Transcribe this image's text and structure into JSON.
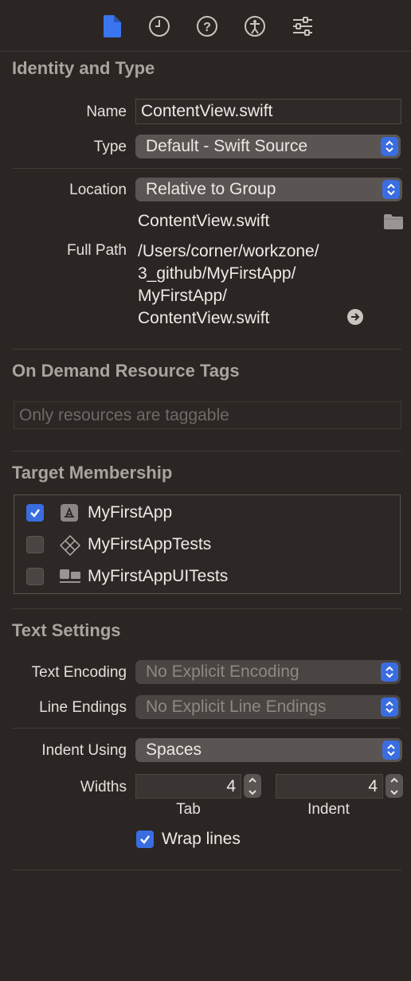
{
  "toolbar": {
    "tabs": [
      {
        "icon": "file-inspector-icon",
        "active": true
      },
      {
        "icon": "history-clock-icon",
        "active": false
      },
      {
        "icon": "help-question-icon",
        "active": false
      },
      {
        "icon": "accessibility-icon",
        "active": false
      },
      {
        "icon": "sliders-icon",
        "active": false
      }
    ],
    "accent": "#3a75f0"
  },
  "identity": {
    "title": "Identity and Type",
    "name_label": "Name",
    "name_value": "ContentView.swift",
    "type_label": "Type",
    "type_value": "Default - Swift Source",
    "location_label": "Location",
    "location_value": "Relative to Group",
    "file_name": "ContentView.swift",
    "full_path_label": "Full Path",
    "full_path_lines": [
      "/Users/corner/workzone/",
      "3_github/MyFirstApp/",
      "MyFirstApp/",
      "ContentView.swift"
    ]
  },
  "odr": {
    "title": "On Demand Resource Tags",
    "placeholder": "Only resources are taggable"
  },
  "target_membership": {
    "title": "Target Membership",
    "targets": [
      {
        "name": "MyFirstApp",
        "checked": true,
        "icon": "app-icon"
      },
      {
        "name": "MyFirstAppTests",
        "checked": false,
        "icon": "test-bundle-icon"
      },
      {
        "name": "MyFirstAppUITests",
        "checked": false,
        "icon": "ui-test-bundle-icon"
      }
    ]
  },
  "text_settings": {
    "title": "Text Settings",
    "encoding_label": "Text Encoding",
    "encoding_value": "No Explicit Encoding",
    "line_endings_label": "Line Endings",
    "line_endings_value": "No Explicit Line Endings",
    "indent_using_label": "Indent Using",
    "indent_using_value": "Spaces",
    "widths_label": "Widths",
    "tab_width": "4",
    "tab_label": "Tab",
    "indent_width": "4",
    "indent_label": "Indent",
    "wrap_lines_label": "Wrap lines",
    "wrap_lines_checked": true
  }
}
